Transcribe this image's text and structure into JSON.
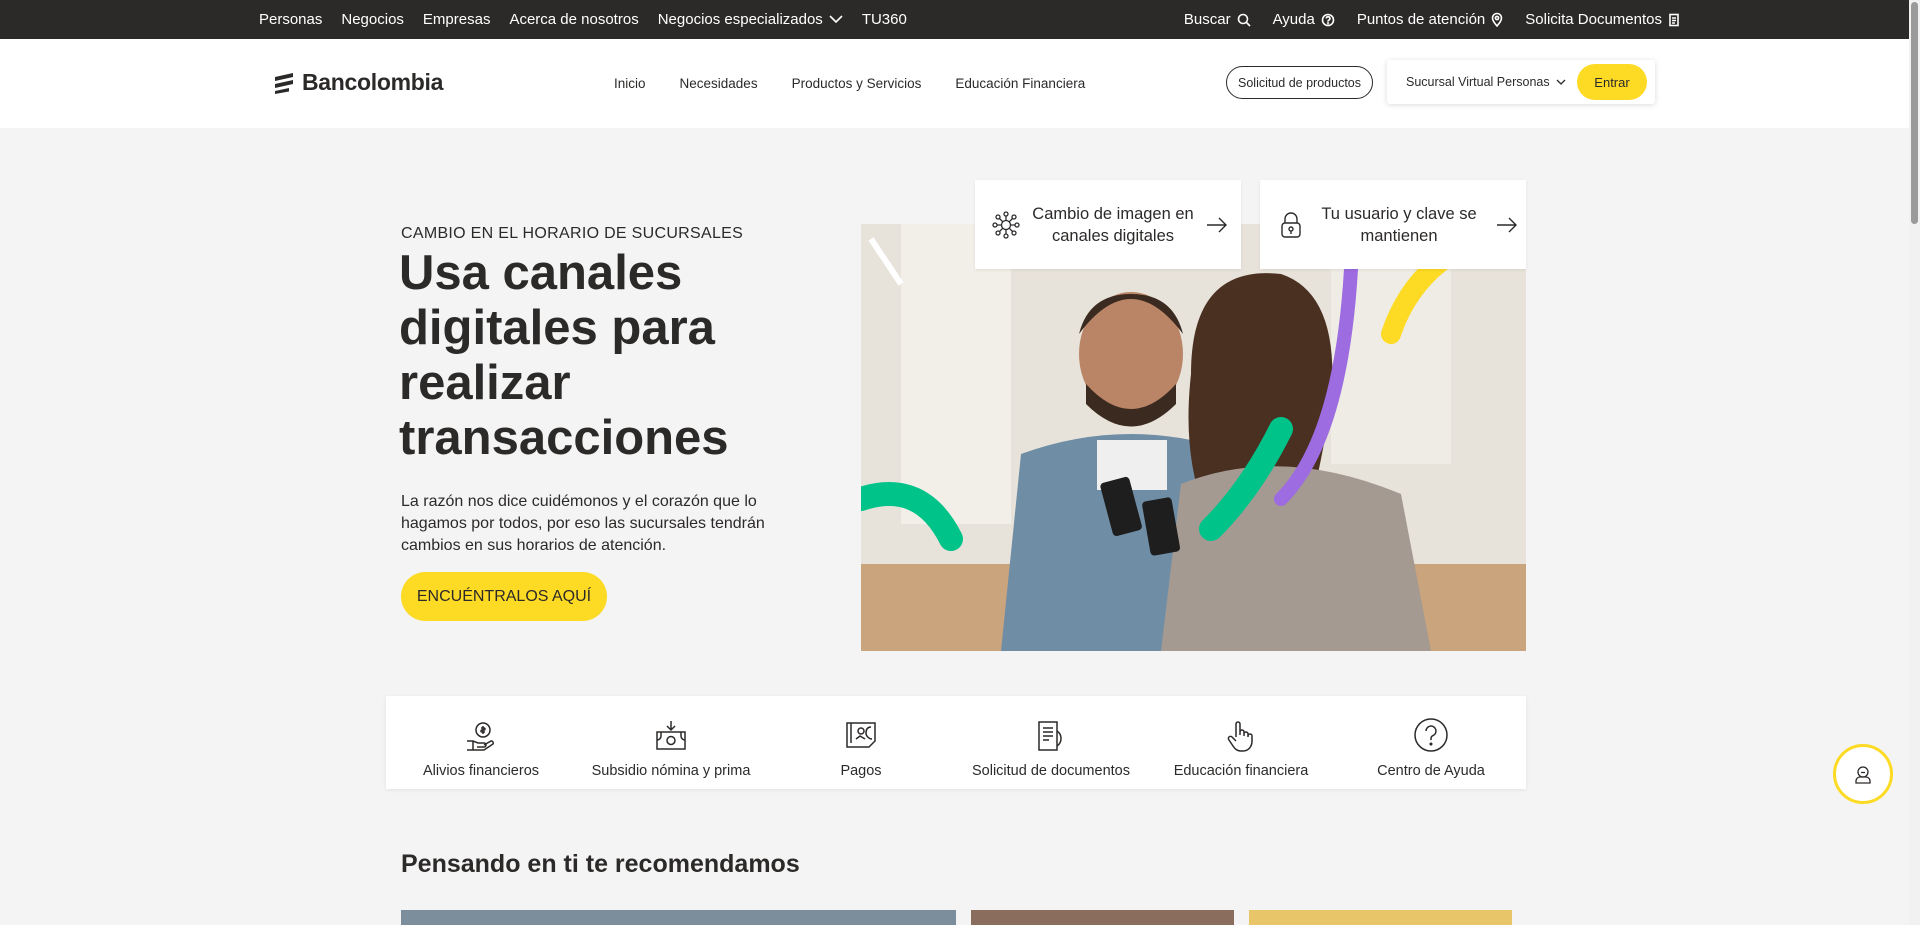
{
  "topbar": {
    "left_items": [
      "Personas",
      "Negocios",
      "Empresas",
      "Acerca de nosotros",
      "Negocios especializados",
      "TU360"
    ],
    "search": "Buscar",
    "help": "Ayuda",
    "points": "Puntos de atención",
    "documents": "Solicita Documentos"
  },
  "header": {
    "logo": "Bancolombia",
    "nav": [
      "Inicio",
      "Necesidades",
      "Productos y Servicios",
      "Educación Financiera"
    ],
    "products_button": "Solicitud de productos",
    "sucursal": "Sucursal Virtual Personas",
    "enter_button": "Entrar"
  },
  "hero": {
    "eyebrow": "CAMBIO EN EL HORARIO DE SUCURSALES",
    "title": "Usa canales digitales para realizar transacciones",
    "description": "La razón nos dice cuidémonos y el corazón que lo hagamos por todos, por eso las sucursales tendrán cambios en sus horarios de atención.",
    "cta": "ENCUÉNTRALOS AQUÍ"
  },
  "info_cards": [
    {
      "label": "Cambio de imagen en canales digitales",
      "icon": "network-icon"
    },
    {
      "label": "Tu usuario y clave se mantienen",
      "icon": "lock-icon"
    }
  ],
  "quick_links": [
    {
      "label": "Alivios financieros",
      "icon": "hand-money-icon"
    },
    {
      "label": "Subsidio nómina y prima",
      "icon": "money-download-icon"
    },
    {
      "label": "Pagos",
      "icon": "payment-icon"
    },
    {
      "label": "Solicitud de documentos",
      "icon": "document-icon"
    },
    {
      "label": "Educación financiera",
      "icon": "finger-icon"
    },
    {
      "label": "Centro de Ayuda",
      "icon": "question-icon"
    }
  ],
  "recommendations": {
    "title": "Pensando en ti te recomendamos"
  },
  "colors": {
    "brand_yellow": "#fdda24",
    "dark": "#2c2a29",
    "accent_green": "#00c389",
    "accent_purple": "#9c6ce0"
  }
}
